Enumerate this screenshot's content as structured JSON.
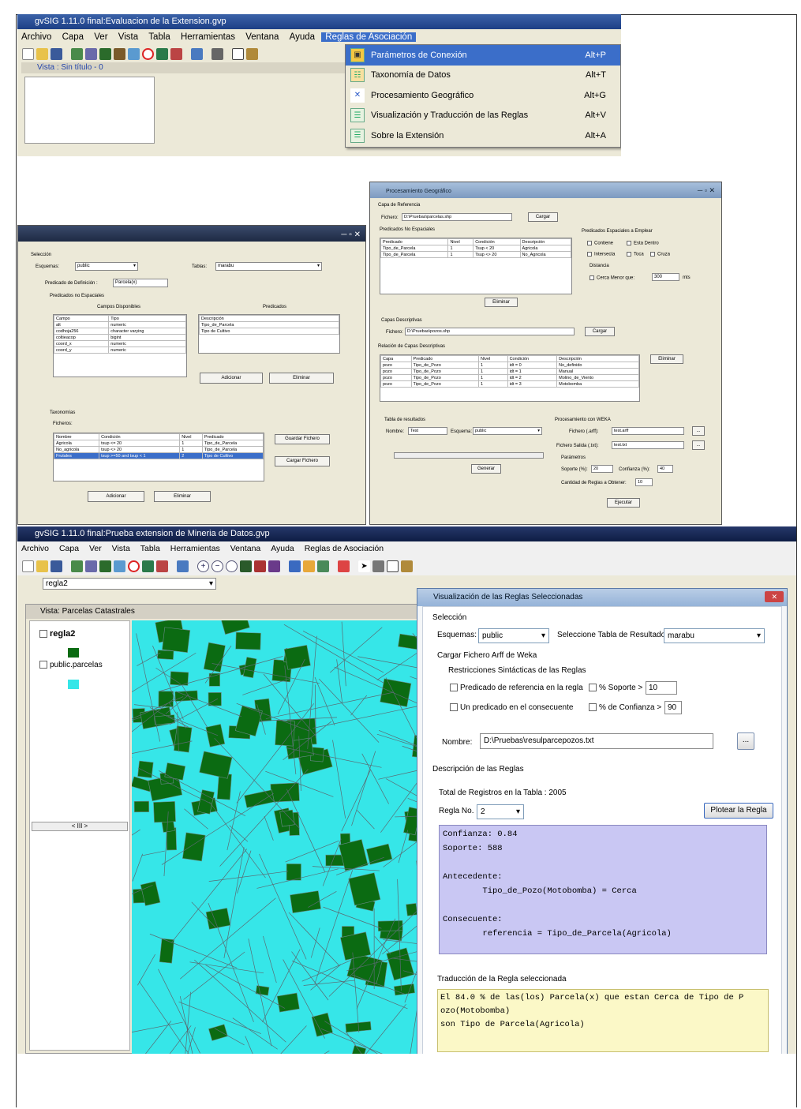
{
  "shot1": {
    "title": "gvSIG 1.11.0 final:Evaluacion de la Extension.gvp",
    "menu": [
      "Archivo",
      "Capa",
      "Ver",
      "Vista",
      "Tabla",
      "Herramientas",
      "Ventana",
      "Ayuda",
      "Reglas de Asociación"
    ],
    "view_title": "Vista : Sin título - 0",
    "dropdown": [
      {
        "label": "Parámetros de Conexión",
        "shortcut": "Alt+P"
      },
      {
        "label": "Taxonomía de Datos",
        "shortcut": "Alt+T"
      },
      {
        "label": "Procesamiento Geográfico",
        "shortcut": "Alt+G"
      },
      {
        "label": "Visualización y Traducción de las Reglas",
        "shortcut": "Alt+V"
      },
      {
        "label": "Sobre la Extensión",
        "shortcut": "Alt+A"
      }
    ]
  },
  "shot2": {
    "seleccion": "Selección",
    "esquema_label": "Esquemas:",
    "esquema_value": "public",
    "tablas_label": "Tablas:",
    "tablas_value": "marabu",
    "pred_def_label": "Predicado de Definición :",
    "pred_def_value": "Parcela(x)",
    "pred_no_esp": "Predicados no Espaciales",
    "campos_disp": "Campos Disponibles",
    "predicados": "Predicados",
    "campos_headers": [
      "Campo",
      "Tipo"
    ],
    "campos_rows": [
      [
        "alt",
        "numeric"
      ],
      [
        "codhoja256",
        "character varying"
      ],
      [
        "coltieacop",
        "bigint"
      ],
      [
        "coord_x",
        "numeric"
      ],
      [
        "coord_y",
        "numeric"
      ]
    ],
    "pred_header": "Descripción",
    "pred_rows": [
      "Tipo_de_Parcela",
      "Tipo de Cultivo"
    ],
    "adicionar": "Adicionar",
    "eliminar": "Eliminar",
    "taxonomias": "Taxonomías",
    "ficheros": "Ficheros:",
    "tax_headers": [
      "Nombre",
      "Condición",
      "Nivel",
      "Predicado"
    ],
    "tax_rows": [
      [
        "Agricola",
        "tsup <= 20",
        "1",
        "Tipo_de_Parcela"
      ],
      [
        "No_agricola",
        "tsup <> 20",
        "1",
        "Tipo_de_Parcela"
      ],
      [
        "Frutales",
        "tsup >=50 and tsup < 1",
        "2",
        "Tipo de Cultivo"
      ]
    ],
    "guardar": "Guardar Fichero",
    "cargar": "Cargar Fichero"
  },
  "shot3": {
    "title": "Procesamiento Geográfico",
    "capa_ref": "Capa de Referencia",
    "fichero_label": "Fichero:",
    "fichero_value": "D:\\Pruebas\\parcelas.shp",
    "cargar": "Cargar",
    "pred_no_esp": "Predicados No Espaciales",
    "pred_headers": [
      "Predicado",
      "Nivel",
      "Condición",
      "Descripción"
    ],
    "pred_rows": [
      [
        "Tipo_de_Parcela",
        "1",
        "Tsup < 20",
        "Agricola"
      ],
      [
        "Tipo_de_Parcela",
        "1",
        "Tsup <> 20",
        "No_Agricola"
      ]
    ],
    "eliminar": "Eliminar",
    "pred_esp": "Predicados Espaciales a Emplear",
    "esp_checks": [
      "Contiene",
      "Esta Dentro",
      "Intersecta",
      "Toca",
      "Cruza"
    ],
    "distancia": "Distancia",
    "cerca_label": "Cerca",
    "menor_que": "Menor que:",
    "cerca_value": "300",
    "unidad": "mts",
    "capas_desc": "Capas Descriptivas",
    "fichero2_value": "D:\\Pruebas\\pozos.shp",
    "relacion": "Relación de Capas Descriptivas",
    "desc_headers": [
      "Capa",
      "Predicado",
      "Nivel",
      "Condición",
      "Descripción"
    ],
    "desc_rows": [
      [
        "pozo",
        "Tipo_de_Pozo",
        "1",
        "idt = 0",
        "No_definido"
      ],
      [
        "pozo",
        "Tipo_de_Pozo",
        "1",
        "idt = 1",
        "Manual"
      ],
      [
        "pozo",
        "Tipo_de_Pozo",
        "1",
        "idt = 2",
        "Molino_de_Viento"
      ],
      [
        "pozo",
        "Tipo_de_Pozo",
        "1",
        "idt = 3",
        "Motobomba"
      ]
    ],
    "tabla_res": "Tabla de resultados",
    "nombre_label": "Nombre:",
    "nombre_value": "Test",
    "esquema_label": "Esquema:",
    "esquema_value": "public",
    "proc_weka": "Procesamiento con WEKA",
    "fichero_arff_label": "Fichero (.arff):",
    "fichero_arff": "test.arff",
    "fichero_salida_label": "Fichero Salida (.txt):",
    "fichero_salida": "test.txt",
    "parametros": "Parámetros",
    "soporte_label": "Soporte (%):",
    "soporte_value": "20",
    "confianza_label": "Confianza (%):",
    "confianza_value": "40",
    "cantidad_label": "Cantidad de Reglas a Obtener:",
    "cantidad_value": "10",
    "generar": "Generar",
    "ejecutar": "Ejecutar",
    "browse": "..."
  },
  "shot4": {
    "title": "gvSIG 1.11.0 final:Prueba extension de Mineria de Datos.gvp",
    "menu": [
      "Archivo",
      "Capa",
      "Ver",
      "Vista",
      "Tabla",
      "Herramientas",
      "Ventana",
      "Ayuda",
      "Reglas de Asociación"
    ],
    "layer_combo": "regla2",
    "view_title": "Vista: Parcelas Catastrales",
    "layers": [
      "regla2",
      "public.parcelas"
    ],
    "scroll_label": "< III >",
    "dialog": {
      "title": "Visualización de las Reglas Seleccionadas",
      "seleccion": "Selección",
      "esquemas_label": "Esquemas:",
      "esquemas_value": "public",
      "tabla_label": "Seleccione Tabla de Resultados:",
      "tabla_value": "marabu",
      "cargar_label": "Cargar Fichero Arff de Weka",
      "restricciones": "Restricciones Sintácticas de las Reglas",
      "chk1": "Predicado de referencia en la regla",
      "chk2": "Un predicado en el consecuente",
      "soporte_label": "% Soporte >",
      "soporte_value": "10",
      "confianza_label": "% de Confianza >",
      "confianza_value": "90",
      "nombre_label": "Nombre:",
      "nombre_value": "D:\\Pruebas\\resulparcepozos.txt",
      "browse": "...",
      "descripcion": "Descripción de las Reglas",
      "total_label": "Total de Registros en la Tabla :",
      "total_value": "2005",
      "regla_label": "Regla No.",
      "regla_value": "2",
      "plotear": "Plotear la Regla",
      "rule_lines": [
        "Confianza: 0.84",
        "Soporte: 588",
        "",
        "Antecedente:",
        "        Tipo_de_Pozo(Motobomba) = Cerca",
        "",
        "Consecuente:",
        "        referencia = Tipo_de_Parcela(Agricola)"
      ],
      "traduccion": "Traducción de la Regla seleccionada",
      "trad_lines": [
        "El 84.0 % de las(los) Parcela(x) que estan Cerca de Tipo de P",
        "ozo(Motobomba)",
        "son Tipo de Parcela(Agricola)"
      ]
    }
  },
  "colors": {
    "window_blue": "#1d3f86",
    "menu_bg": "#ece9d8",
    "map_cyan": "#36e6e8",
    "map_green": "#0b6b12",
    "rule_bg": "#c9c7f3",
    "trad_bg": "#fbf8c7"
  }
}
